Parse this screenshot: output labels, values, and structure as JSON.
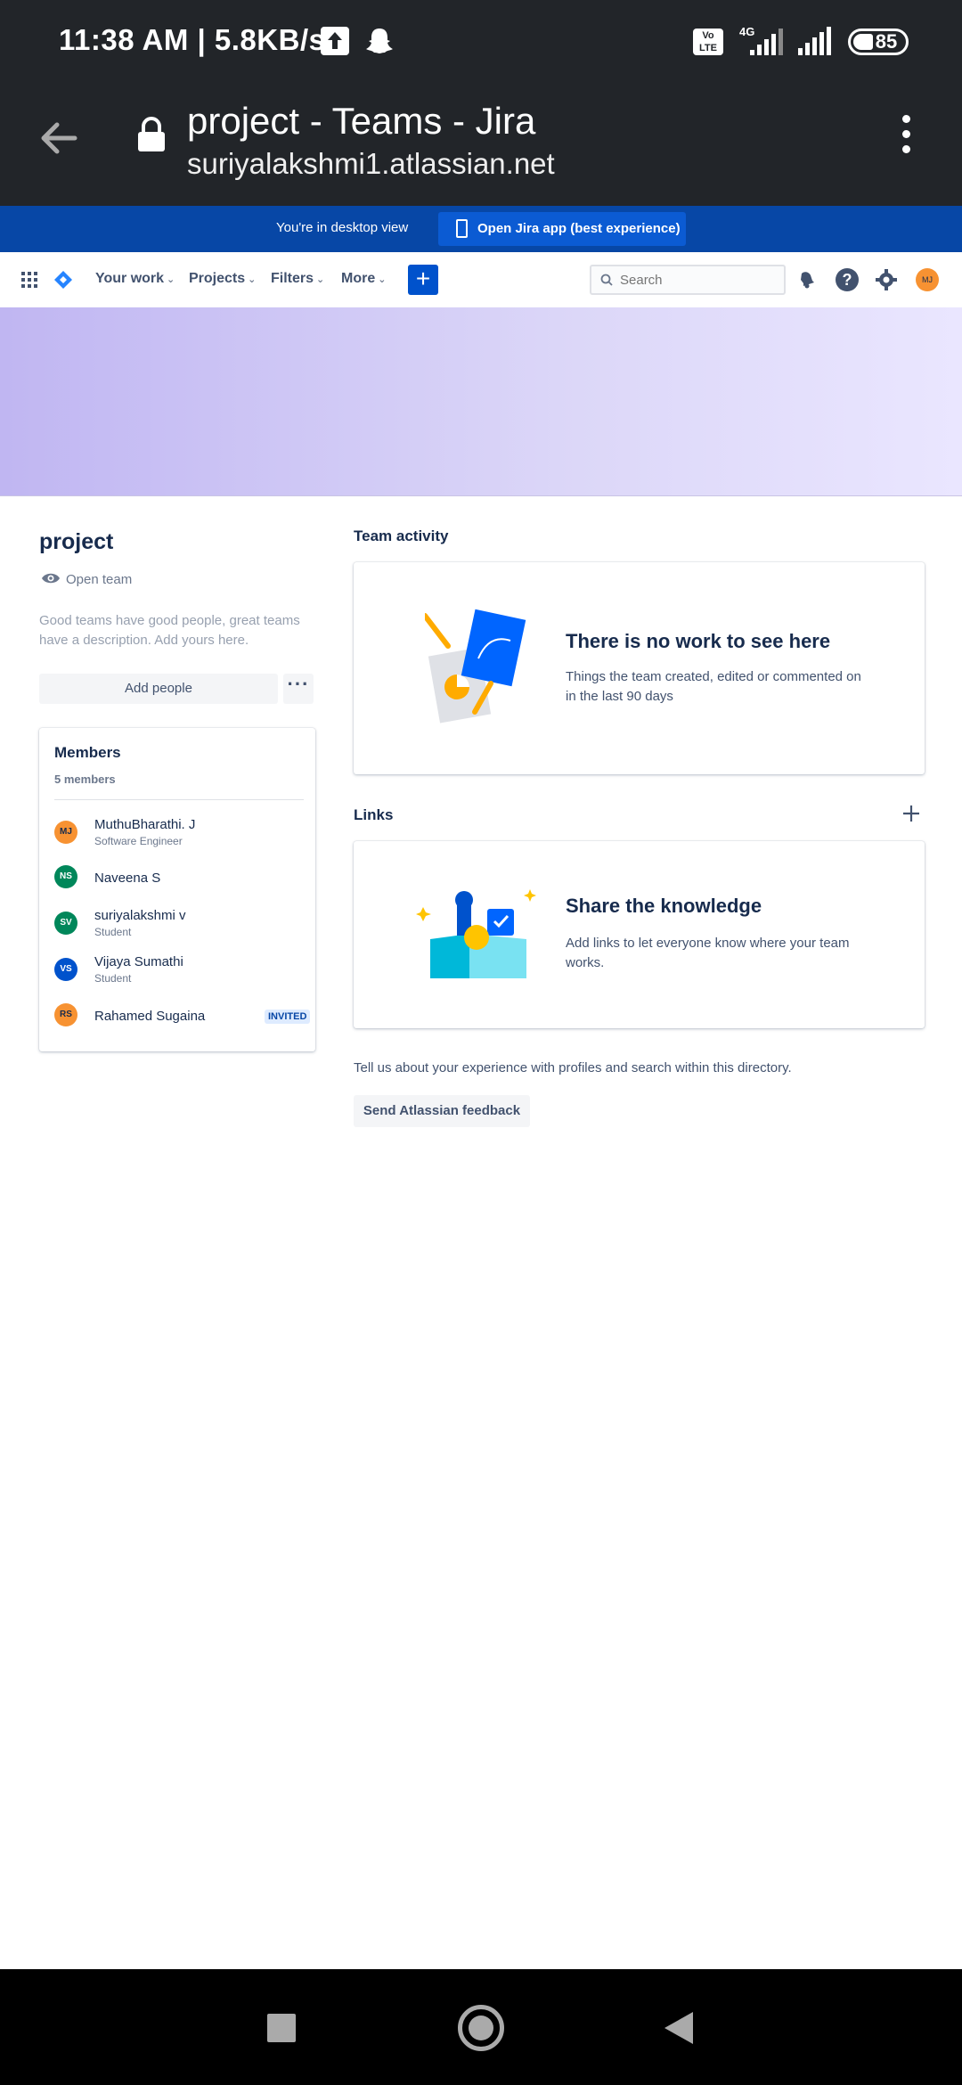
{
  "status_bar": {
    "time": "11:38 AM | 5.8KB/s",
    "network": "4G",
    "volte": "Vo LTE",
    "battery": "85"
  },
  "browser": {
    "title": "project - Teams - Jira",
    "url": "suriyalakshmi1.atlassian.net"
  },
  "banner": {
    "text": "You're in desktop view",
    "button": "Open Jira app (best experience)"
  },
  "nav": {
    "items": [
      "Your work",
      "Projects",
      "Filters",
      "More"
    ],
    "search_placeholder": "Search",
    "avatar_initials": "MJ",
    "help": "?"
  },
  "team": {
    "name": "project",
    "type": "Open team",
    "description": "Good teams have good people, great teams have a description. Add yours here.",
    "add_people": "Add people"
  },
  "members": {
    "title": "Members",
    "count": "5 members",
    "list": [
      {
        "initials": "MJ",
        "name": "MuthuBharathi. J",
        "role": "Software Engineer",
        "color": "#f79232",
        "badge": ""
      },
      {
        "initials": "NS",
        "name": "Naveena S",
        "role": "",
        "color": "#00875a",
        "badge": ""
      },
      {
        "initials": "SV",
        "name": "suriyalakshmi v",
        "role": "Student",
        "color": "#00875a",
        "badge": ""
      },
      {
        "initials": "VS",
        "name": "Vijaya Sumathi",
        "role": "Student",
        "color": "#0052cc",
        "badge": ""
      },
      {
        "initials": "RS",
        "name": "Rahamed Sugaina",
        "role": "",
        "color": "#f79232",
        "badge": "INVITED"
      }
    ]
  },
  "activity": {
    "title": "Team activity",
    "heading": "There is no work to see here",
    "text": "Things the team created, edited or commented on in the last 90 days"
  },
  "links": {
    "title": "Links",
    "heading": "Share the knowledge",
    "text": "Add links to let everyone know where your team works."
  },
  "feedback": {
    "text": "Tell us about your experience with profiles and search within this directory.",
    "button": "Send Atlassian feedback"
  },
  "colors": {
    "jira_blue": "#0052cc",
    "banner_blue": "#0747a6",
    "header_purple": "#c0b6f2"
  }
}
